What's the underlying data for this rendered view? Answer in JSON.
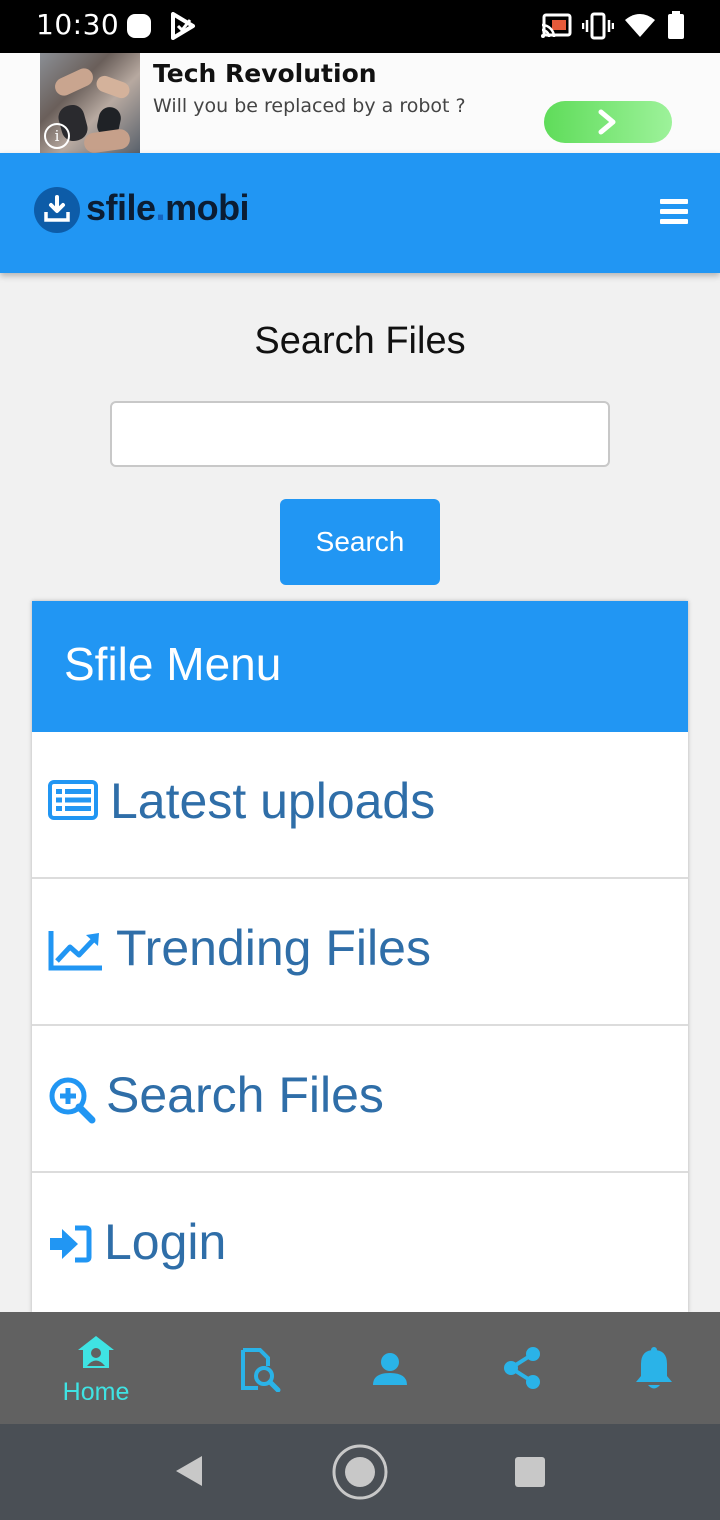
{
  "status_bar": {
    "time": "10:30"
  },
  "ad": {
    "title": "Tech Revolution",
    "subtitle": "Will you be replaced by a robot ?",
    "info_glyph": "i"
  },
  "header": {
    "logo_text_main": "sfile",
    "logo_text_dot": ".",
    "logo_text_tld": "mobi",
    "accent_color": "#2196f3"
  },
  "search": {
    "title": "Search Files",
    "input_value": "",
    "button_label": "Search"
  },
  "menu": {
    "title": "Sfile Menu",
    "items": [
      {
        "label": "Latest uploads",
        "icon": "list-icon"
      },
      {
        "label": "Trending Files",
        "icon": "trending-chart-icon"
      },
      {
        "label": "Search Files",
        "icon": "search-plus-icon"
      },
      {
        "label": "Login",
        "icon": "sign-in-icon"
      }
    ]
  },
  "bottom_nav": {
    "active_color": "#3fe3e3",
    "icon_color": "#2ab3e8",
    "items": [
      {
        "label": "Home",
        "icon": "home-user-icon"
      },
      {
        "icon": "file-search-icon"
      },
      {
        "icon": "person-icon"
      },
      {
        "icon": "share-icon"
      },
      {
        "icon": "bell-icon"
      }
    ]
  }
}
